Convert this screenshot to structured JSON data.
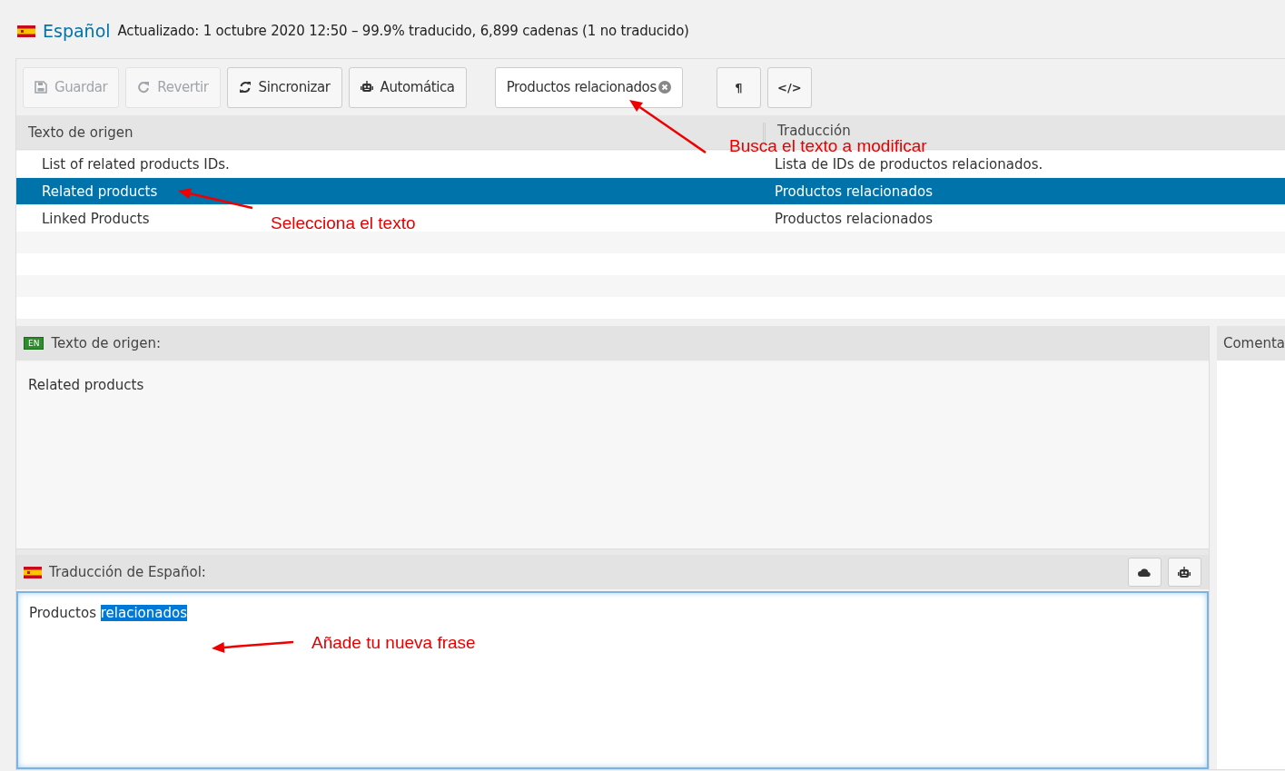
{
  "header": {
    "language": "Español",
    "status": "Actualizado: 1 octubre 2020 12:50 – 99.9% traducido, 6,899 cadenas (1 no traducido)"
  },
  "toolbar": {
    "buttons": [
      {
        "label": "Guardar",
        "kind": "save",
        "disabled": true
      },
      {
        "label": "Revertir",
        "kind": "revert",
        "disabled": true
      },
      {
        "label": "Sincronizar",
        "kind": "sync",
        "disabled": false
      },
      {
        "label": "Automática",
        "kind": "robot",
        "disabled": false
      }
    ],
    "search": {
      "value": "Productos relacionados"
    },
    "toggles": [
      {
        "label": "¶"
      },
      {
        "label": "</>"
      }
    ]
  },
  "table": {
    "columns": [
      "Texto de origen",
      "Traducción"
    ],
    "rows": [
      {
        "source": "List of related products IDs.",
        "translation": "Lista de IDs de productos relacionados.",
        "selected": false
      },
      {
        "source": "Related products",
        "translation": "Productos relacionados",
        "selected": true
      },
      {
        "source": "Linked Products",
        "translation": "Productos relacionados",
        "selected": false
      }
    ]
  },
  "source_panel": {
    "badge": "EN",
    "title": "Texto de origen:",
    "text": "Related products"
  },
  "translation_panel": {
    "title": "Traducción de Español:",
    "value_parts": [
      {
        "text": "Productos",
        "selected": false
      },
      {
        "text": "relacionados",
        "selected": true
      }
    ]
  },
  "comments_panel": {
    "title": "Comenta"
  },
  "annotations": [
    {
      "text": "Busca el texto a modificar"
    },
    {
      "text": "Selecciona el texto"
    },
    {
      "text": "Añade tu nueva frase"
    }
  ]
}
